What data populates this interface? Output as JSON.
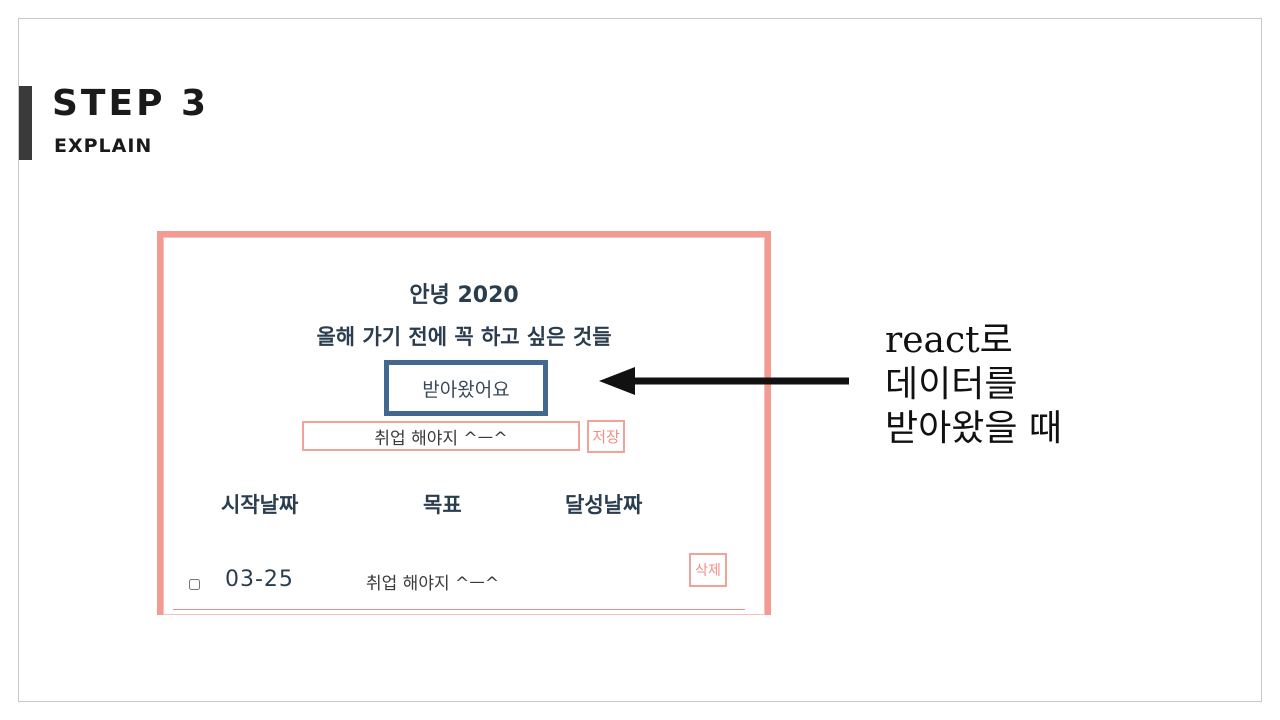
{
  "slide": {
    "title": "STEP 3",
    "subtitle": "EXPLAIN"
  },
  "app": {
    "greeting": "안녕 2020",
    "subheading": "올해 가기 전에 꼭 하고 싶은 것들",
    "received_label": "받아왔어요",
    "input_value": "취업 해야지 ^ㅡ^",
    "save_label": "저장",
    "columns": {
      "start": "시작날짜",
      "goal": "목표",
      "done": "달성날짜"
    },
    "rows": [
      {
        "date": "03-25",
        "goal": "취업 해야지 ^ㅡ^",
        "delete_label": "삭제",
        "checked": false
      }
    ]
  },
  "callout": {
    "line1": "react로",
    "line2": "데이터를",
    "line3": "받아왔을  때"
  },
  "colors": {
    "accent_bar": "#3a3a3a",
    "frame_border": "#f39b92",
    "highlight_box": "#43688f",
    "heading_text": "#2a3d4f"
  }
}
